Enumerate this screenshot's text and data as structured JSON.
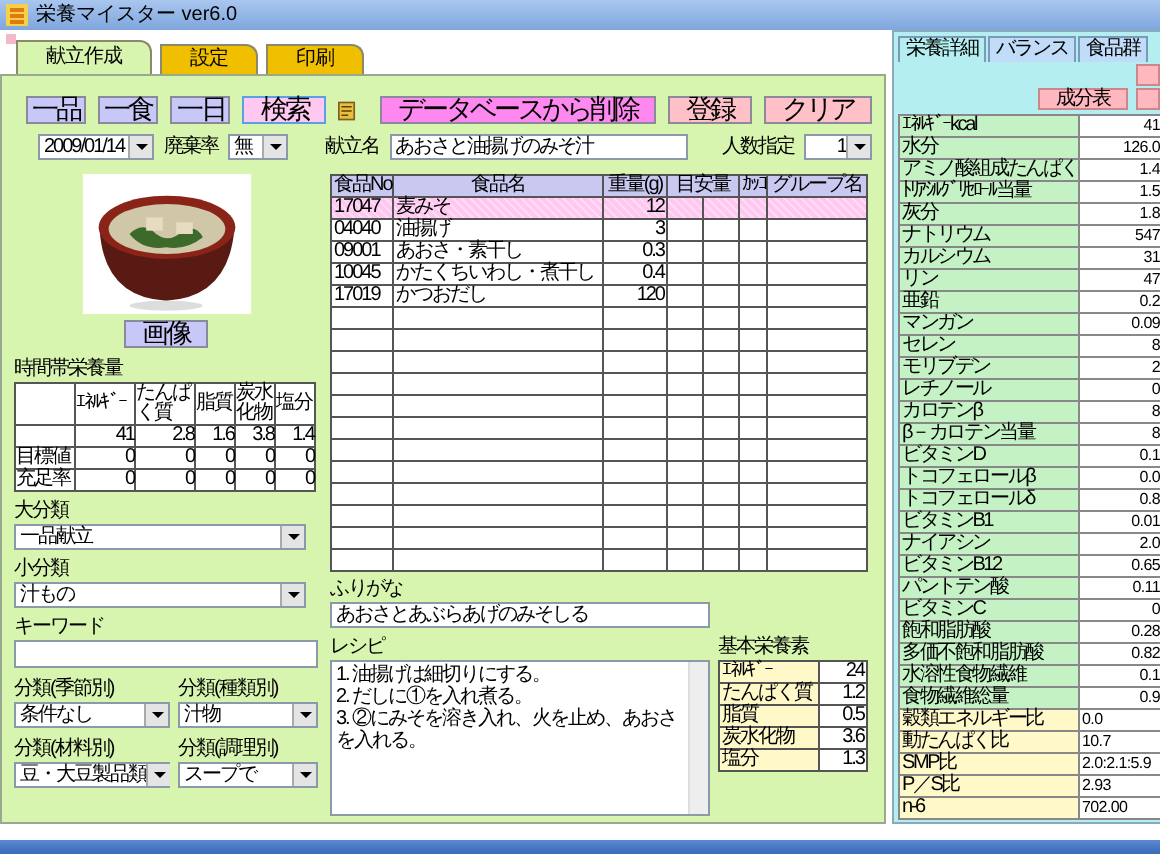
{
  "window": {
    "title": "栄養マイスター ver6.0"
  },
  "tabs": [
    {
      "label": "献立作成",
      "selected": true
    },
    {
      "label": "設定",
      "selected": false
    },
    {
      "label": "印刷",
      "selected": false
    }
  ],
  "mode_buttons": [
    "一品",
    "一食",
    "一日"
  ],
  "search_button": "検索",
  "action_buttons": [
    {
      "label": "データベースから削除",
      "kind": "delete"
    },
    {
      "label": "登録",
      "kind": "save"
    },
    {
      "label": "クリア",
      "kind": "clear"
    }
  ],
  "date": {
    "value": "2009/01/14"
  },
  "waste_rate": {
    "label": "廃棄率",
    "value": "無"
  },
  "menu_name": {
    "label": "献立名",
    "value": "あおさと油揚げのみそ汁"
  },
  "servings": {
    "label": "人数指定",
    "value": "1"
  },
  "image_button": "画像",
  "time_nutrition": {
    "title": "時間帯栄養量",
    "columns": [
      "ｴﾈﾙｷﾞｰ",
      "たんぱく質",
      "脂質",
      "炭水化物",
      "塩分"
    ],
    "rows": [
      {
        "values": [
          "41",
          "2.8",
          "1.6",
          "3.8",
          "1.4"
        ]
      },
      {
        "label": "目標値",
        "values": [
          "0",
          "0",
          "0",
          "0",
          "0"
        ]
      },
      {
        "label": "充足率",
        "values": [
          "0",
          "0",
          "0",
          "0",
          "0"
        ]
      }
    ]
  },
  "categories": [
    {
      "label": "大分類",
      "value": "一品献立"
    },
    {
      "label": "小分類",
      "value": "汁もの"
    }
  ],
  "keyword": {
    "label": "キーワード"
  },
  "classifications": [
    {
      "label": "分類(季節別)",
      "value": "条件なし"
    },
    {
      "label": "分類(種類別)",
      "value": "汁物"
    },
    {
      "label": "分類(材料別)",
      "value": "豆・大豆製品類"
    },
    {
      "label": "分類(調理別)",
      "value": "スープで"
    }
  ],
  "food_table": {
    "columns": [
      "食品No",
      "食品名",
      "重量(g)",
      "目安量",
      "ｶｯｺ",
      "グループ名"
    ],
    "rows": [
      {
        "no": "17047",
        "name": "麦みそ",
        "weight": "12",
        "selected": true
      },
      {
        "no": "04040",
        "name": "油揚げ",
        "weight": "3",
        "selected": false
      },
      {
        "no": "09001",
        "name": "あおさ・素干し",
        "weight": "0.3",
        "selected": false
      },
      {
        "no": "10045",
        "name": "かたくちいわし・煮干し",
        "weight": "0.4",
        "selected": false
      },
      {
        "no": "17019",
        "name": "かつおだし",
        "weight": "120",
        "selected": false
      }
    ]
  },
  "furigana": {
    "label": "ふりがな",
    "value": "あおさとあぶらあげのみそしる"
  },
  "recipe": {
    "label": "レシピ",
    "lines": [
      "1. 油揚げは細切りにする。",
      "2. だしに①を入れ煮る。",
      "3. ②にみそを溶き入れ、火を止め、あおさを入れる。"
    ]
  },
  "basic_nutrients": {
    "title": "基本栄養素",
    "rows": [
      {
        "label": "ｴﾈﾙｷﾞｰ",
        "value": "24"
      },
      {
        "label": "たんぱく質",
        "value": "1.2"
      },
      {
        "label": "脂質",
        "value": "0.5"
      },
      {
        "label": "炭水化物",
        "value": "3.6"
      },
      {
        "label": "塩分",
        "value": "1.3"
      }
    ]
  },
  "nutrient_panel": {
    "tabs": [
      {
        "label": "栄養詳細",
        "selected": true
      },
      {
        "label": "バランス",
        "selected": false
      },
      {
        "label": "食品群",
        "selected": false
      }
    ],
    "button_rows": [
      [
        {
          "kind": "blank"
        }
      ],
      [
        {
          "kind": "labeled",
          "label": "成分表"
        },
        {
          "kind": "blank"
        }
      ]
    ],
    "rows": [
      {
        "label": "ｴﾈﾙｷﾞｰkcal",
        "value": "41",
        "kind": "nutrient"
      },
      {
        "label": "水分",
        "value": "126.0",
        "kind": "nutrient"
      },
      {
        "label": "アミノ酸組成たんぱく",
        "value": "1.4",
        "kind": "nutrient"
      },
      {
        "label": "ﾄﾘｱｼﾙｸﾞﾘｾﾛｰﾙ当量",
        "value": "1.5",
        "kind": "nutrient"
      },
      {
        "label": "灰分",
        "value": "1.8",
        "kind": "nutrient"
      },
      {
        "label": "ナトリウム",
        "value": "547",
        "kind": "nutrient"
      },
      {
        "label": "カルシウム",
        "value": "31",
        "kind": "nutrient"
      },
      {
        "label": "リン",
        "value": "47",
        "kind": "nutrient"
      },
      {
        "label": "亜鉛",
        "value": "0.2",
        "kind": "nutrient"
      },
      {
        "label": "マンガン",
        "value": "0.09",
        "kind": "nutrient"
      },
      {
        "label": "セレン",
        "value": "8",
        "kind": "nutrient"
      },
      {
        "label": "モリブデン",
        "value": "2",
        "kind": "nutrient"
      },
      {
        "label": "レチノール",
        "value": "0",
        "kind": "nutrient"
      },
      {
        "label": "カロテンβ",
        "value": "8",
        "kind": "nutrient"
      },
      {
        "label": "β－カロテン当量",
        "value": "8",
        "kind": "nutrient"
      },
      {
        "label": "ビタミンD",
        "value": "0.1",
        "kind": "nutrient"
      },
      {
        "label": "トコフェロールβ",
        "value": "0.0",
        "kind": "nutrient"
      },
      {
        "label": "トコフェロールδ",
        "value": "0.8",
        "kind": "nutrient"
      },
      {
        "label": "ビタミンB1",
        "value": "0.01",
        "kind": "nutrient"
      },
      {
        "label": "ナイアシン",
        "value": "2.0",
        "kind": "nutrient"
      },
      {
        "label": "ビタミンB12",
        "value": "0.65",
        "kind": "nutrient"
      },
      {
        "label": "パントテン酸",
        "value": "0.11",
        "kind": "nutrient"
      },
      {
        "label": "ビタミンC",
        "value": "0",
        "kind": "nutrient"
      },
      {
        "label": "飽和脂肪酸",
        "value": "0.28",
        "kind": "nutrient"
      },
      {
        "label": "多価不飽和脂肪酸",
        "value": "0.82",
        "kind": "nutrient"
      },
      {
        "label": "水溶性食物繊維",
        "value": "0.1",
        "kind": "nutrient"
      },
      {
        "label": "食物繊維総量",
        "value": "0.9",
        "kind": "nutrient"
      },
      {
        "label": "穀類エネルギー比",
        "value": "0.0",
        "kind": "ratio"
      },
      {
        "label": "動たんぱく比",
        "value": "10.7",
        "kind": "ratio"
      },
      {
        "label": "SMP比",
        "value": "2.0:2.1:5.9",
        "kind": "ratio"
      },
      {
        "label": "P／S比",
        "value": "2.93",
        "kind": "ratio"
      },
      {
        "label": "n-6",
        "value": "702.00",
        "kind": "ratio"
      }
    ]
  }
}
